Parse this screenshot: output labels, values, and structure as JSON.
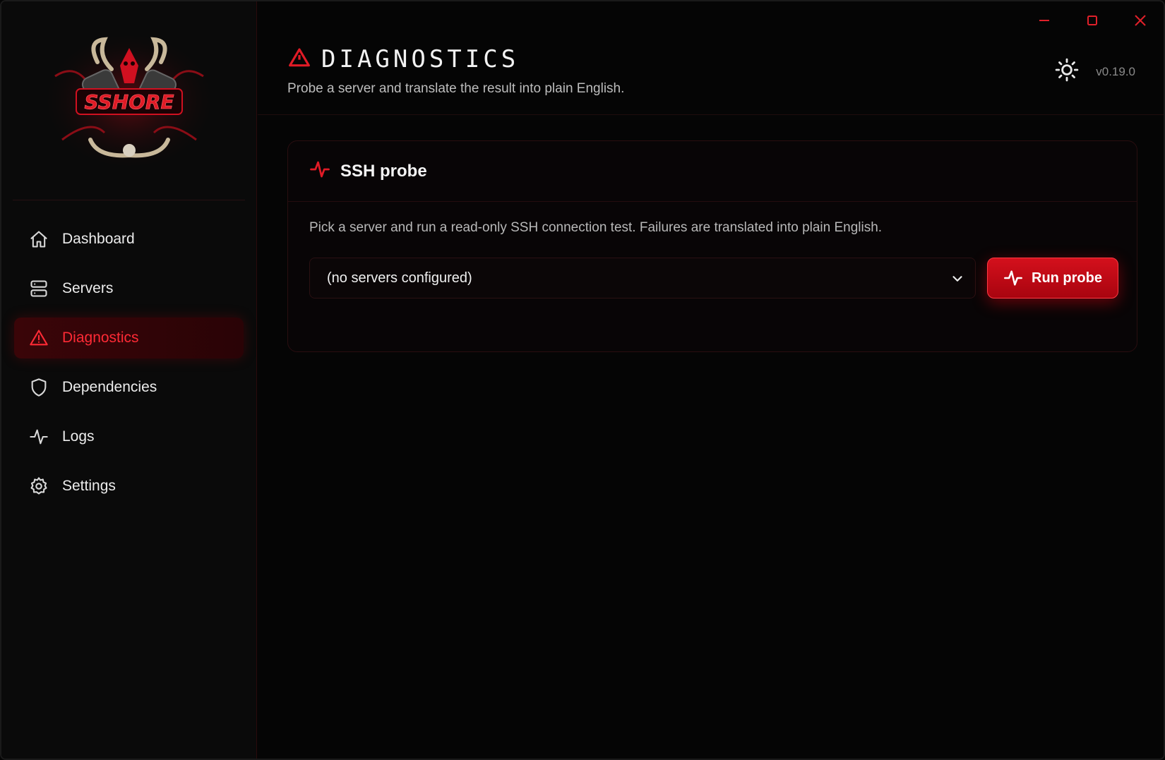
{
  "window": {
    "controls": [
      "minimize",
      "maximize",
      "close"
    ],
    "accent_color": "#e01b26"
  },
  "sidebar": {
    "logo_text": "SSHORE",
    "items": [
      {
        "label": "Dashboard",
        "icon": "home-icon",
        "active": false
      },
      {
        "label": "Servers",
        "icon": "server-icon",
        "active": false
      },
      {
        "label": "Diagnostics",
        "icon": "warning-icon",
        "active": true
      },
      {
        "label": "Dependencies",
        "icon": "shield-icon",
        "active": false
      },
      {
        "label": "Logs",
        "icon": "activity-icon",
        "active": false
      },
      {
        "label": "Settings",
        "icon": "gear-icon",
        "active": false
      }
    ]
  },
  "header": {
    "title": "DIAGNOSTICS",
    "subtitle": "Probe a server and translate the result into plain English.",
    "version": "v0.19.0"
  },
  "card": {
    "title": "SSH probe",
    "description": "Pick a server and run a read-only SSH connection test. Failures are translated into plain English.",
    "select_value": "(no servers configured)",
    "run_label": "Run probe"
  }
}
